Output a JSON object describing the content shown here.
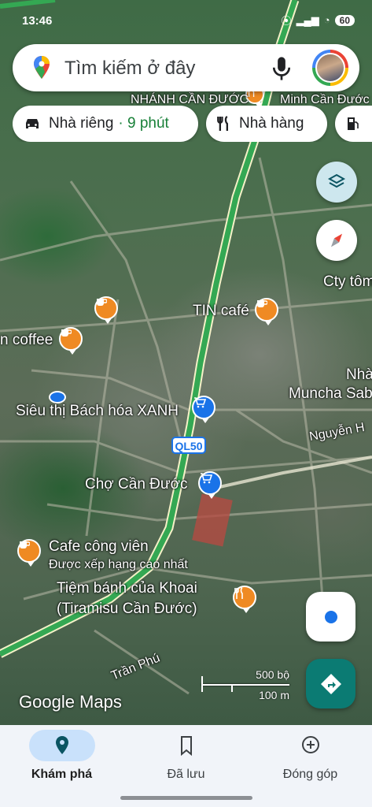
{
  "status_bar": {
    "time": "13:46",
    "battery": "60"
  },
  "search": {
    "placeholder": "Tìm kiếm ở đây"
  },
  "chips": [
    {
      "label": "Nhà riêng",
      "detail": "· 9 phút",
      "icon": "car-icon"
    },
    {
      "label": "Nhà hàng",
      "icon": "restaurant-icon"
    },
    {
      "label": "",
      "icon": "gas-station-icon"
    }
  ],
  "map_labels": {
    "tin_cafe": "TIN café",
    "coffee": "n coffee",
    "cty_tom": "Cty tôm",
    "nha": "Nhà",
    "muncha": "Muncha Sab",
    "nguyen": "Nguyễn H",
    "sieu_thi": "Siêu thị Bách hóa XANH",
    "cho": "Chợ Cần Đước",
    "cafe_cong_vien": "Cafe công viên",
    "cafe_cong_vien_sub": "Được xếp hạng cao nhất",
    "tiem_banh_1": "Tiệm bánh của Khoai",
    "tiem_banh_2": "(Tiramisu Cần Đước)",
    "tran_phu": "Trần Phú",
    "top_cut_1": "NHÁNH CẦN ĐƯỚC",
    "top_cut_2": "Minh Cần Đước"
  },
  "route_shield": "QL50",
  "scale": {
    "imperial": "500 bộ",
    "metric": "100 m"
  },
  "brand": "Google Maps",
  "bottom_nav": [
    {
      "label": "Khám phá",
      "icon": "explore-pin-icon",
      "active": true
    },
    {
      "label": "Đã lưu",
      "icon": "bookmark-icon",
      "active": false
    },
    {
      "label": "Đóng góp",
      "icon": "add-circle-icon",
      "active": false
    }
  ],
  "colors": {
    "route": "#34a853",
    "poi_food": "#ef8a23",
    "poi_shop": "#1a73e8",
    "nav_active": "#c9e1fb",
    "directions": "#0b7b73"
  }
}
